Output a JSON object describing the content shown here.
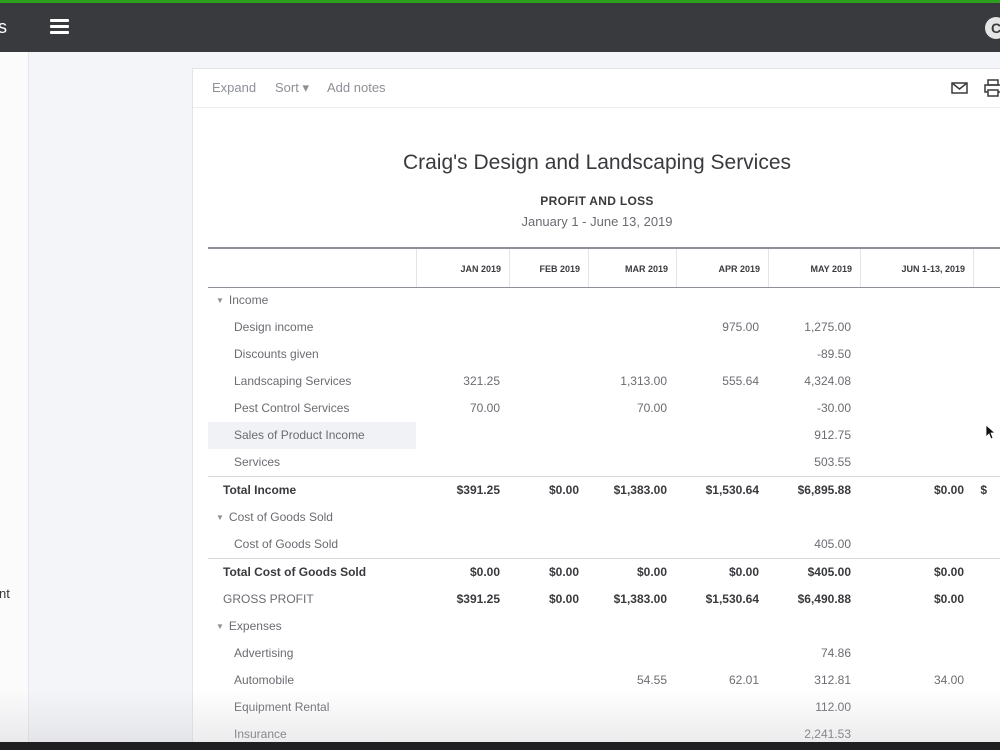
{
  "topbar": {
    "brand_fragment": "s",
    "avatar_initial": "C"
  },
  "sidebar": {
    "item_fragment": "nt"
  },
  "toolbar": {
    "expand": "Expand",
    "sort": "Sort ▾",
    "add_notes": "Add notes",
    "icons": [
      "email-icon",
      "print-icon"
    ]
  },
  "report": {
    "company": "Craig's Design and Landscaping Services",
    "title": "PROFIT AND LOSS",
    "date_range": "January 1 - June 13, 2019",
    "columns": [
      "JAN 2019",
      "FEB 2019",
      "MAR 2019",
      "APR 2019",
      "MAY 2019",
      "JUN 1-13, 2019"
    ],
    "rows": [
      {
        "label": "Income",
        "kind": "section",
        "values": [
          "",
          "",
          "",
          "",
          "",
          ""
        ]
      },
      {
        "label": "Design income",
        "kind": "item",
        "values": [
          "",
          "",
          "",
          "975.00",
          "1,275.00",
          ""
        ]
      },
      {
        "label": "Discounts given",
        "kind": "item",
        "values": [
          "",
          "",
          "",
          "",
          "-89.50",
          ""
        ]
      },
      {
        "label": "Landscaping Services",
        "kind": "item",
        "values": [
          "321.25",
          "",
          "1,313.00",
          "555.64",
          "4,324.08",
          ""
        ]
      },
      {
        "label": "Pest Control Services",
        "kind": "item",
        "values": [
          "70.00",
          "",
          "70.00",
          "",
          "-30.00",
          ""
        ]
      },
      {
        "label": "Sales of Product Income",
        "kind": "item",
        "highlight": true,
        "values": [
          "",
          "",
          "",
          "",
          "912.75",
          ""
        ]
      },
      {
        "label": "Services",
        "kind": "item",
        "values": [
          "",
          "",
          "",
          "",
          "503.55",
          ""
        ]
      },
      {
        "label": "Total Income",
        "kind": "total",
        "values": [
          "$391.25",
          "$0.00",
          "$1,383.00",
          "$1,530.64",
          "$6,895.88",
          "$0.00"
        ]
      },
      {
        "label": "Cost of Goods Sold",
        "kind": "section",
        "values": [
          "",
          "",
          "",
          "",
          "",
          ""
        ]
      },
      {
        "label": "Cost of Goods Sold",
        "kind": "item",
        "values": [
          "",
          "",
          "",
          "",
          "405.00",
          ""
        ]
      },
      {
        "label": "Total Cost of Goods Sold",
        "kind": "total",
        "values": [
          "$0.00",
          "$0.00",
          "$0.00",
          "$0.00",
          "$405.00",
          "$0.00"
        ]
      },
      {
        "label": "GROSS PROFIT",
        "kind": "gross",
        "values": [
          "$391.25",
          "$0.00",
          "$1,383.00",
          "$1,530.64",
          "$6,490.88",
          "$0.00"
        ]
      },
      {
        "label": "Expenses",
        "kind": "section",
        "values": [
          "",
          "",
          "",
          "",
          "",
          ""
        ]
      },
      {
        "label": "Advertising",
        "kind": "item",
        "values": [
          "",
          "",
          "",
          "",
          "74.86",
          ""
        ]
      },
      {
        "label": "Automobile",
        "kind": "item",
        "values": [
          "",
          "",
          "54.55",
          "62.01",
          "312.81",
          "34.00"
        ]
      },
      {
        "label": "Equipment Rental",
        "kind": "item",
        "values": [
          "",
          "",
          "",
          "",
          "112.00",
          ""
        ]
      },
      {
        "label": "Insurance",
        "kind": "item",
        "values": [
          "",
          "",
          "",
          "",
          "2,241.53",
          ""
        ]
      }
    ],
    "overflow_cell": "$"
  }
}
